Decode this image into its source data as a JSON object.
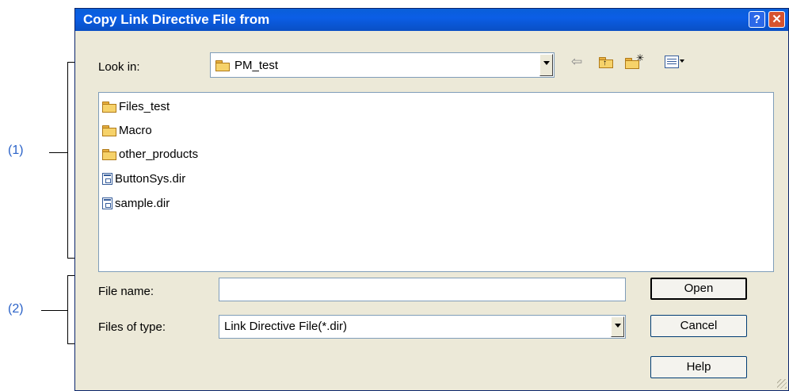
{
  "callouts": [
    "(1)",
    "(2)"
  ],
  "dialog": {
    "title": "Copy Link Directive File from",
    "help_glyph": "?",
    "close_glyph": "✕"
  },
  "look_in": {
    "label": "Look in:",
    "value": "PM_test"
  },
  "toolbar": {
    "back_icon": "back-arrow-icon",
    "up_icon": "up-one-level-icon",
    "new_folder_icon": "new-folder-icon",
    "view_menu_icon": "view-menu-icon"
  },
  "files": [
    {
      "name": "Files_test",
      "icon": "folder-icon"
    },
    {
      "name": "Macro",
      "icon": "folder-icon"
    },
    {
      "name": "other_products",
      "icon": "folder-icon"
    },
    {
      "name": "ButtonSys.dir",
      "icon": "file-icon"
    },
    {
      "name": "sample.dir",
      "icon": "file-icon"
    }
  ],
  "file_name": {
    "label": "File name:",
    "value": ""
  },
  "file_type": {
    "label": "Files of type:",
    "value": "Link Directive File(*.dir)"
  },
  "buttons": {
    "open": "Open",
    "cancel": "Cancel",
    "help": "Help"
  },
  "colors": {
    "titlebar": "#0a5fd8",
    "dialog_bg": "#ece9d8",
    "callout": "#2a62c8"
  }
}
